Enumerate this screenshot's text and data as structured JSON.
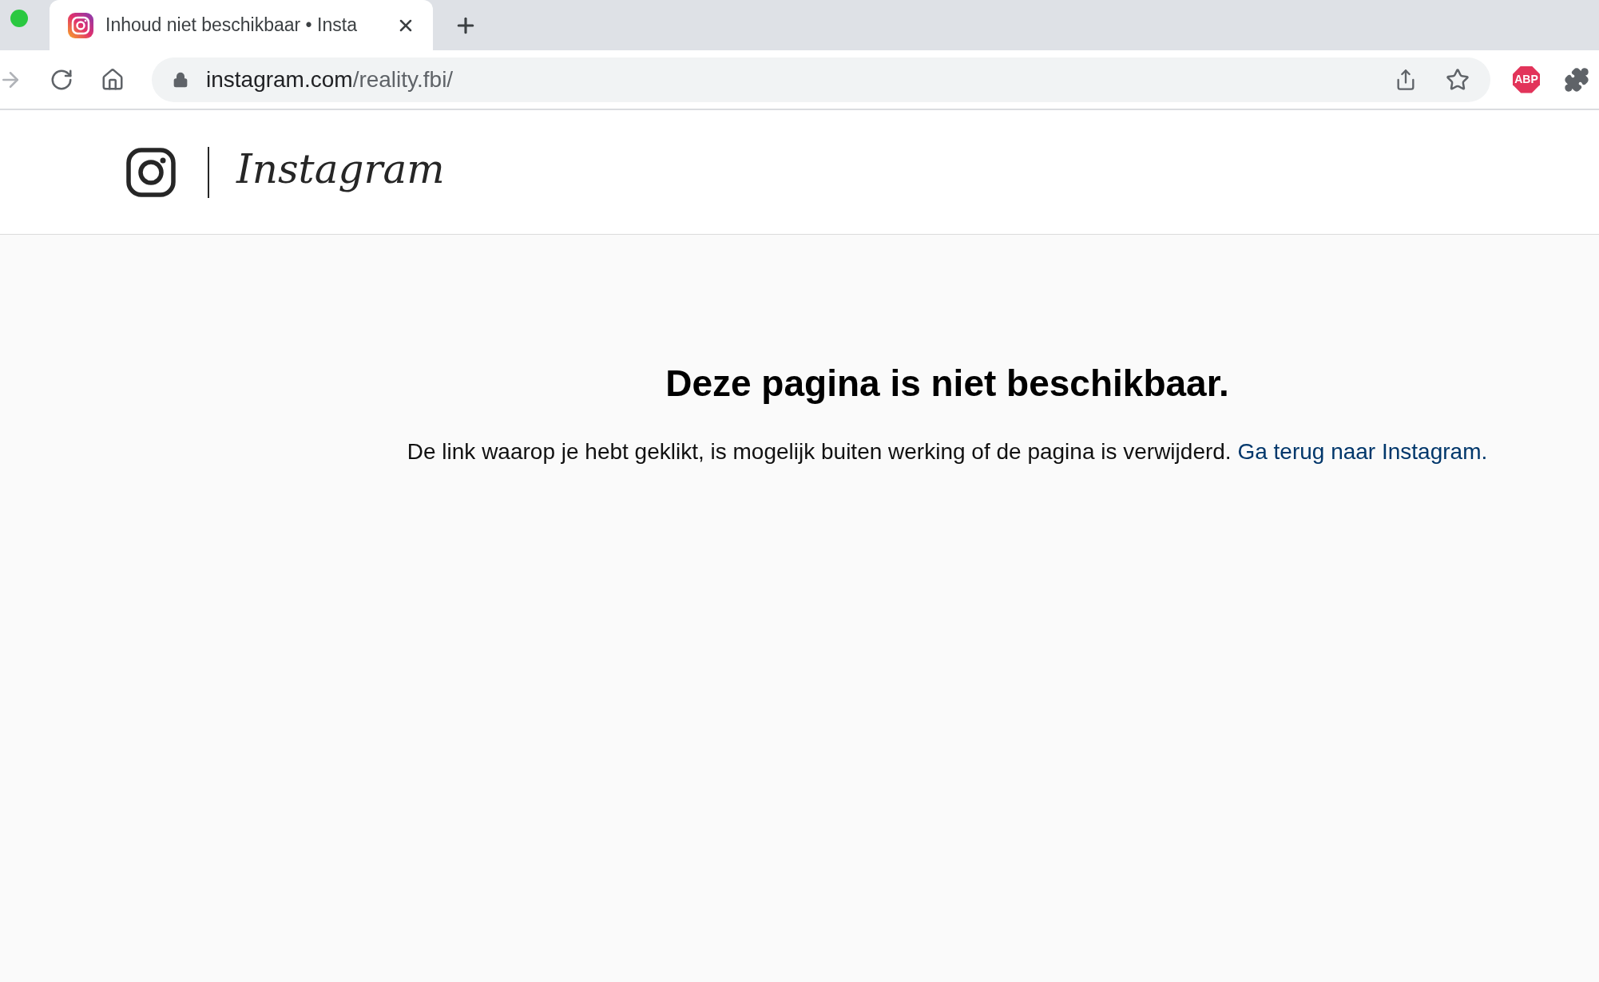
{
  "browser": {
    "tab": {
      "title": "Inhoud niet beschikbaar • Insta",
      "selected": true
    },
    "url": {
      "host": "instagram.com",
      "path": "/reality.fbi/"
    },
    "extension_badge": "ABP"
  },
  "header": {
    "logo_text": "Instagram"
  },
  "error": {
    "heading": "Deze pagina is niet beschikbaar.",
    "message": "De link waarop je hebt geklikt, is mogelijk buiten werking of de pagina is verwijderd.",
    "link": "Ga terug naar Instagram."
  }
}
